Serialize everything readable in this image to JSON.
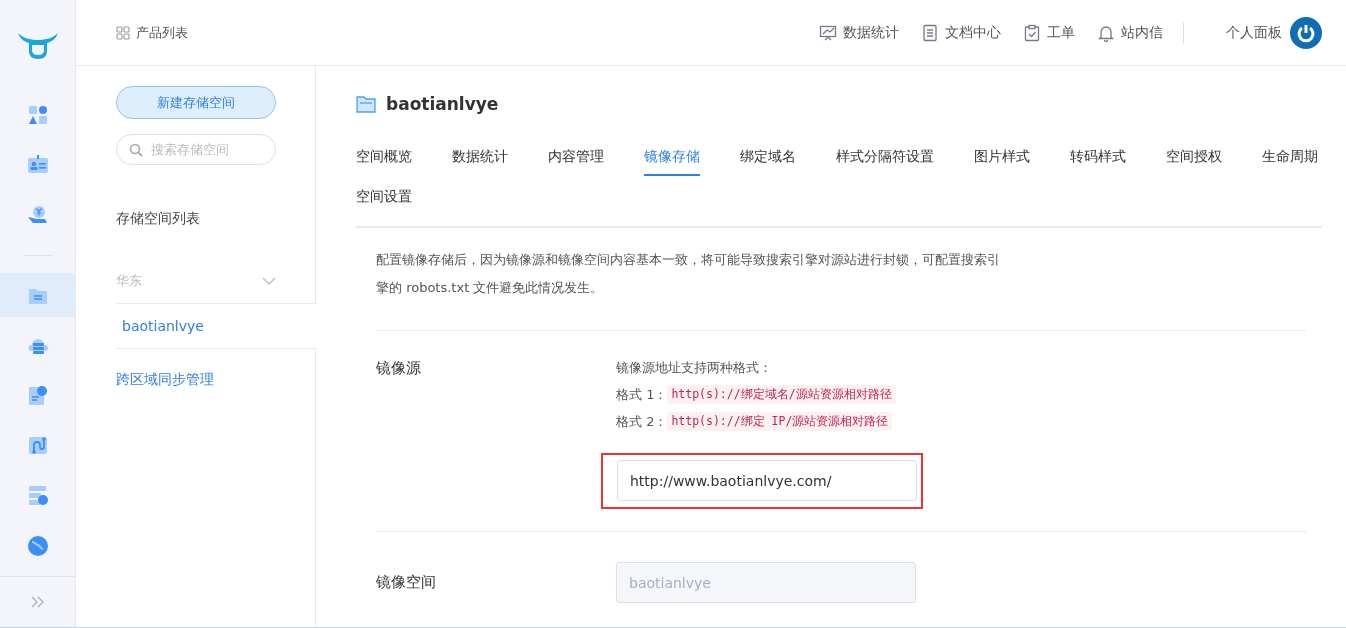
{
  "rail": {
    "top": [
      {
        "kind": "apps",
        "selected": false
      },
      {
        "kind": "badge",
        "selected": false
      },
      {
        "kind": "billing",
        "selected": false
      }
    ],
    "items": [
      {
        "kind": "storage",
        "selected": true
      },
      {
        "kind": "cloud",
        "selected": false
      },
      {
        "kind": "report",
        "selected": false
      },
      {
        "kind": "route",
        "selected": false
      },
      {
        "kind": "server",
        "selected": false
      },
      {
        "kind": "globe",
        "selected": false
      }
    ]
  },
  "header": {
    "product_list": "产品列表",
    "nav": [
      {
        "kind": "chart",
        "label": "数据统计"
      },
      {
        "kind": "doc",
        "label": "文档中心"
      },
      {
        "kind": "ticket",
        "label": "工单"
      },
      {
        "kind": "bell",
        "label": "站内信"
      }
    ],
    "profile": "个人面板"
  },
  "sidebar": {
    "new_button": "新建存储空间",
    "search": {
      "placeholder": "搜索存储空间"
    },
    "list_title": "存储空间列表",
    "region": {
      "label": "华东",
      "expanded": true,
      "buckets": [
        {
          "label": "baotianlvye",
          "selected": true
        }
      ]
    },
    "sync_link": "跨区域同步管理"
  },
  "bucket": {
    "title": "baotianlvye"
  },
  "tabs": [
    {
      "label": "空间概览",
      "selected": false
    },
    {
      "label": "数据统计",
      "selected": false
    },
    {
      "label": "内容管理",
      "selected": false
    },
    {
      "label": "镜像存储",
      "selected": true
    },
    {
      "label": "绑定域名",
      "selected": false
    },
    {
      "label": "样式分隔符设置",
      "selected": false
    },
    {
      "label": "图片样式",
      "selected": false
    },
    {
      "label": "转码样式",
      "selected": false
    },
    {
      "label": "空间授权",
      "selected": false
    },
    {
      "label": "生命周期",
      "selected": false
    },
    {
      "label": "空间设置",
      "selected": false
    }
  ],
  "notice": "配置镜像存储后，因为镜像源和镜像空间内容基本一致，将可能导致搜索引擎对源站进行封锁，可配置搜索引擎的 robots.txt 文件避免此情况发生。",
  "mirror_source": {
    "label": "镜像源",
    "hint": "镜像源地址支持两种格式：",
    "formats": [
      {
        "label": "格式 1：",
        "code": "http(s)://绑定域名/源站资源相对路径"
      },
      {
        "label": "格式 2：",
        "code": "http(s)://绑定 IP/源站资源相对路径"
      }
    ],
    "value": "http://www.baotianlvye.com/",
    "highlighted": true
  },
  "mirror_space": {
    "label": "镜像空间",
    "value": "baotianlvye",
    "disabled": true
  }
}
